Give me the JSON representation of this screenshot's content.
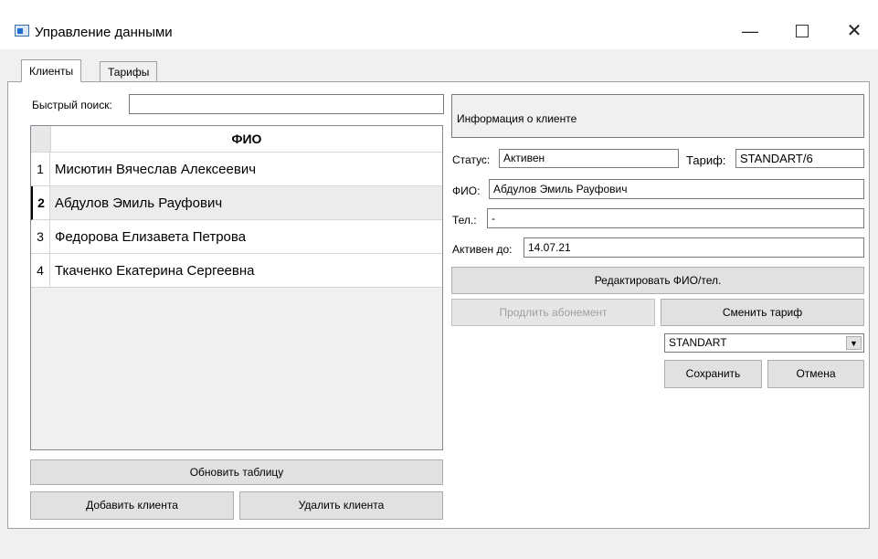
{
  "window": {
    "title": "Управление данными",
    "minimize_glyph": "—",
    "close_glyph": "✕"
  },
  "tabs": [
    {
      "label": "Клиенты",
      "active": true
    },
    {
      "label": "Тарифы",
      "active": false
    }
  ],
  "search": {
    "label": "Быстрый поиск:",
    "value": ""
  },
  "table": {
    "column_header": "ФИО",
    "rows": [
      {
        "num": "1",
        "name": "Мисютин Вячеслав Алексеевич"
      },
      {
        "num": "2",
        "name": "Абдулов Эмиль Рауфович",
        "selected": true
      },
      {
        "num": "3",
        "name": "Федорова Елизавета Петрова"
      },
      {
        "num": "4",
        "name": "Ткаченко Екатерина Сергеевна"
      }
    ]
  },
  "buttons": {
    "refresh": "Обновить таблицу",
    "add_client": "Добавить клиента",
    "delete_client": "Удалить клиента",
    "edit": "Редактировать ФИО/тел.",
    "extend": "Продлить абонемент",
    "change_tariff": "Сменить тариф",
    "save": "Сохранить",
    "cancel": "Отмена"
  },
  "info": {
    "header": "Информация о клиенте",
    "status_label": "Статус:",
    "status_value": "Активен",
    "tariff_label": "Тариф:",
    "tariff_value": "STANDART/6",
    "fio_label": "ФИО:",
    "fio_value": "Абдулов Эмиль Рауфович",
    "phone_label": "Тел.:",
    "phone_value": "-",
    "active_until_label": "Активен до:",
    "active_until_value": "14.07.21"
  },
  "tariff_select": {
    "selected": "STANDART",
    "arrow_glyph": "▼"
  }
}
